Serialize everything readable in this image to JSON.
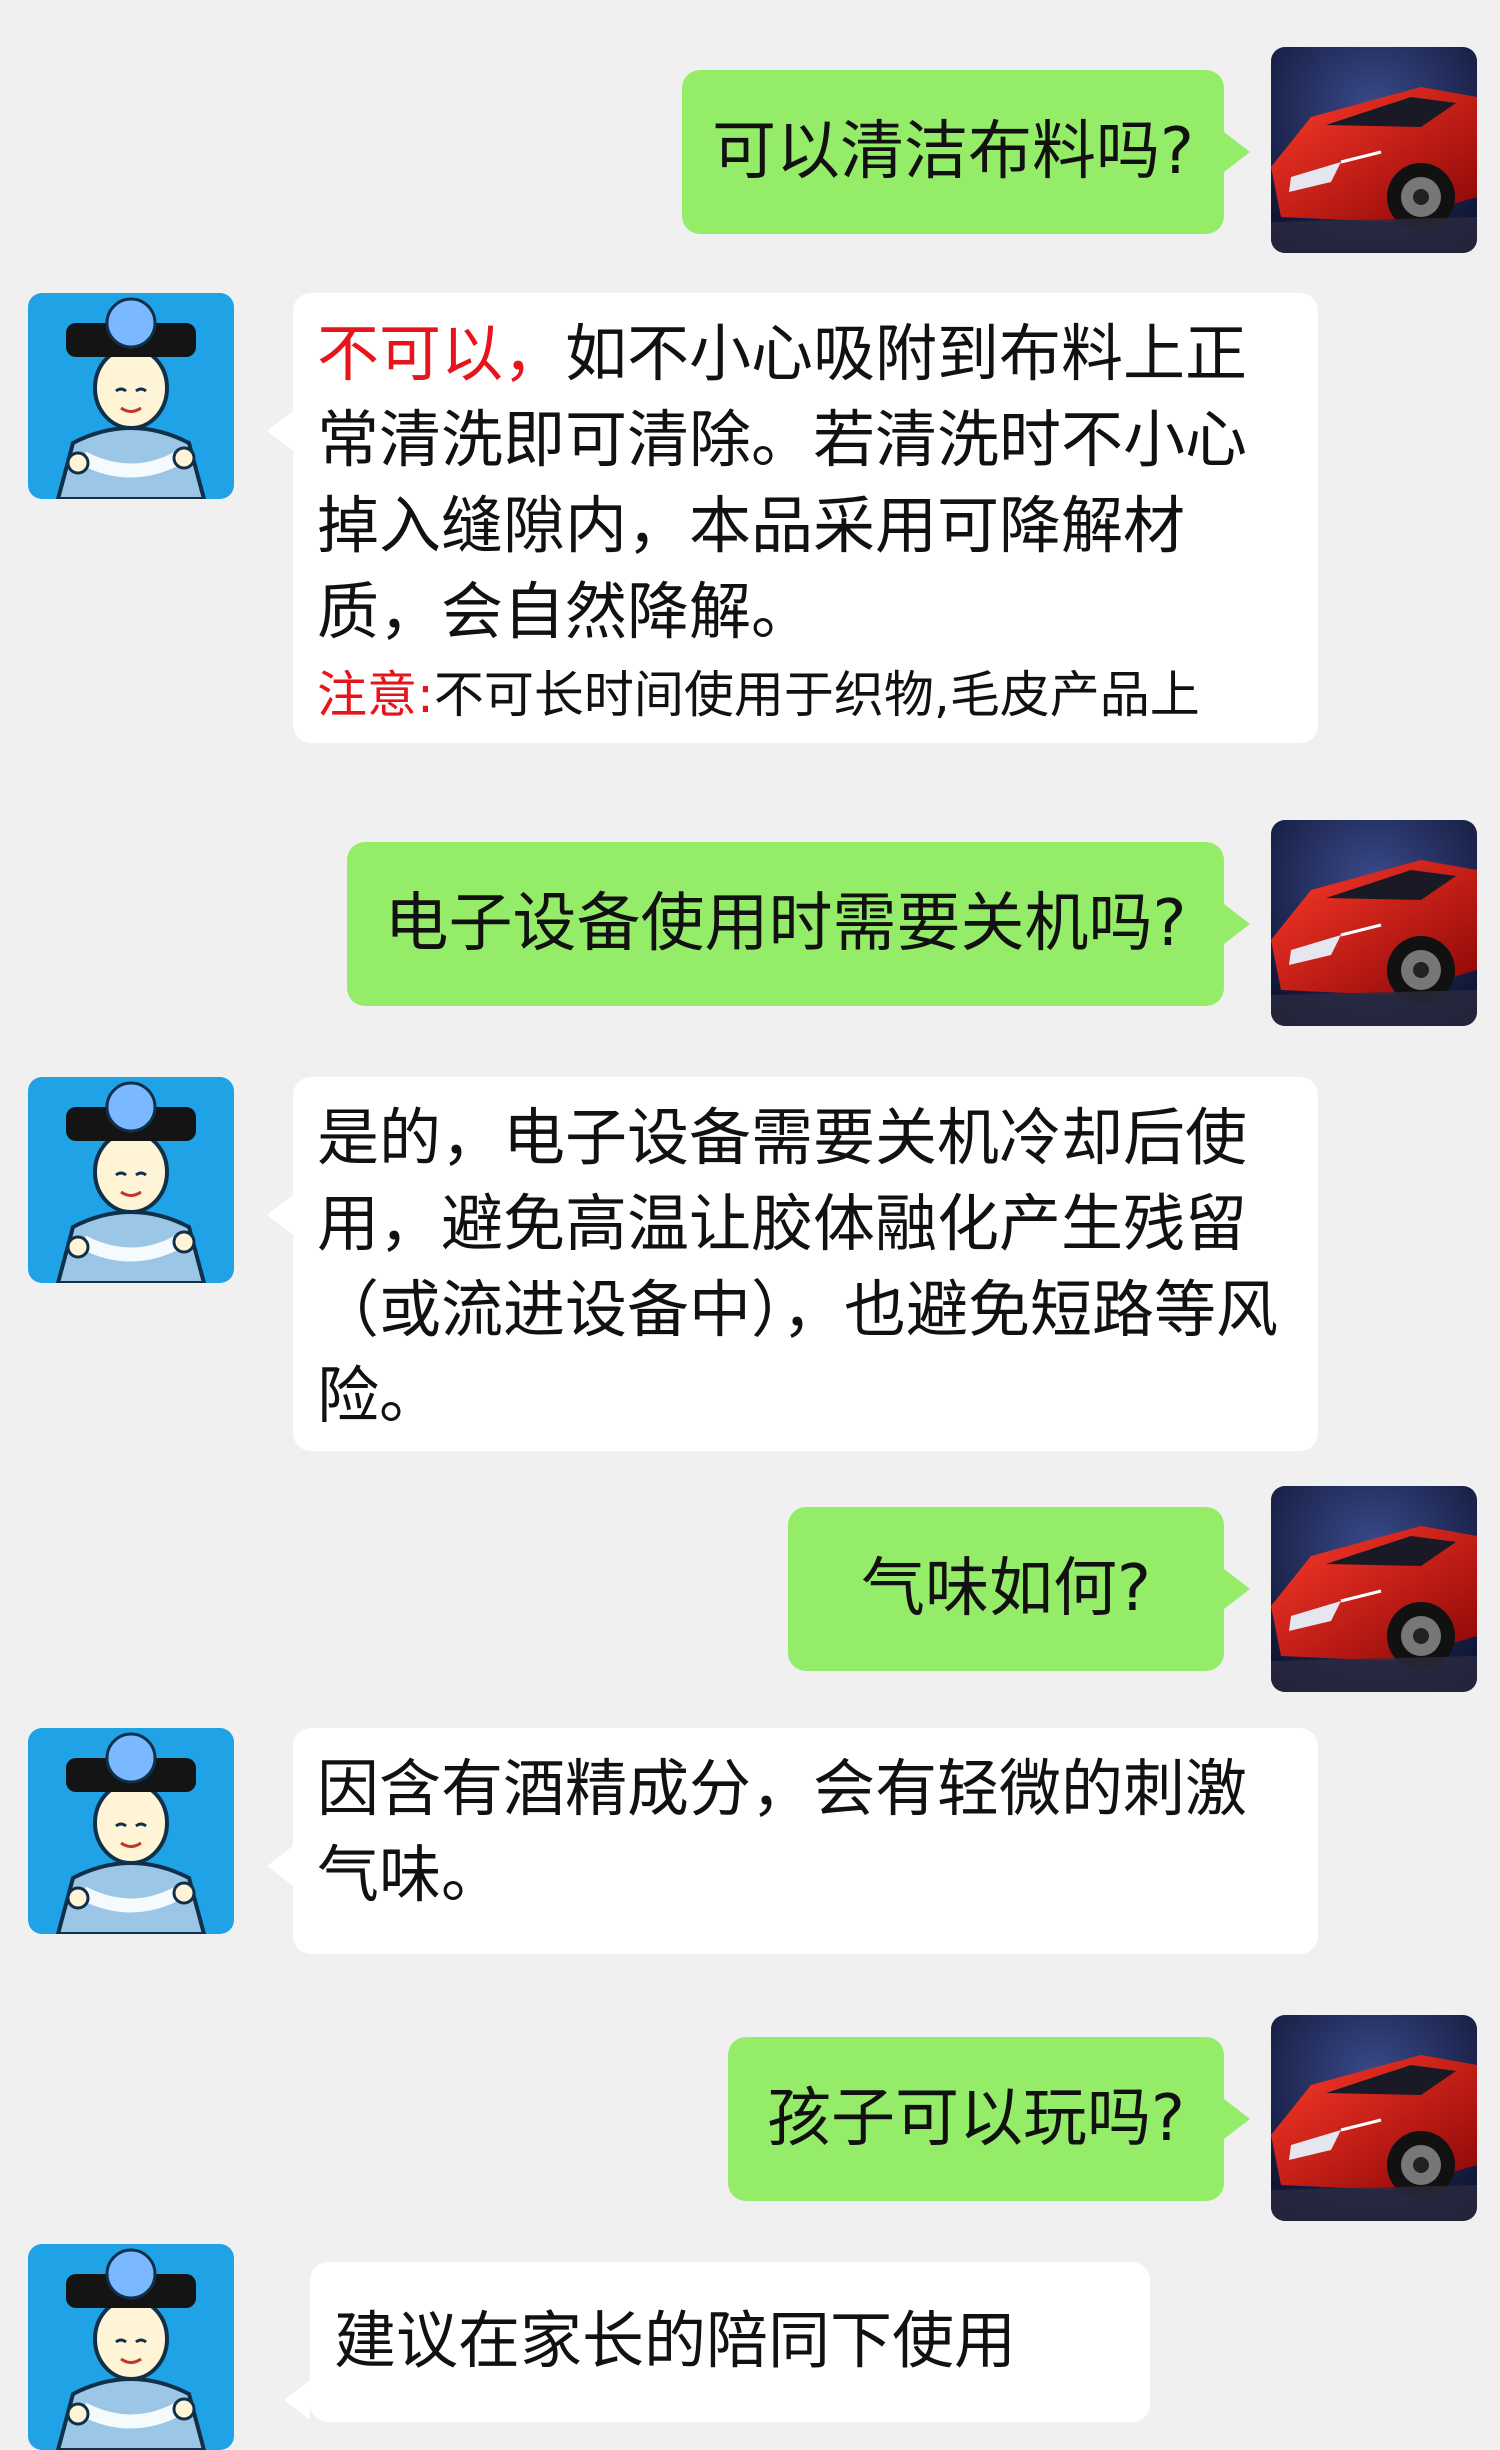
{
  "messages": [
    {
      "side": "out",
      "text": "可以清洁布料吗?"
    },
    {
      "side": "in",
      "lead": "不可以，",
      "text": "如不小心吸附到布料上正常清洗即可清除。若清洗时不小心掉入缝隙内，本品采用可降解材质，会自然降解。",
      "note_label": "注意:",
      "note_text": "不可长时间使用于织物,毛皮产品上"
    },
    {
      "side": "out",
      "text": "电子设备使用时需要关机吗?"
    },
    {
      "side": "in",
      "text": "是的，电子设备需要关机冷却后使用，避免高温让胶体融化产生残留（或流进设备中），也避免短路等风险。"
    },
    {
      "side": "out",
      "text": "气味如何?"
    },
    {
      "side": "in",
      "text": "因含有酒精成分，会有轻微的刺激气味。"
    },
    {
      "side": "out",
      "text": "孩子可以玩吗?"
    },
    {
      "side": "in",
      "text": "建议在家长的陪同下使用"
    }
  ],
  "icons": {
    "user_avatar": "red-sports-car-avatar-icon",
    "bot_avatar": "qing-palace-lady-avatar-icon"
  },
  "colors": {
    "background": "#f0f0f0",
    "outgoing_bubble": "#95ec69",
    "incoming_bubble": "#ffffff",
    "accent_red": "#e8141b",
    "bot_avatar_bg": "#1fa3e6"
  }
}
